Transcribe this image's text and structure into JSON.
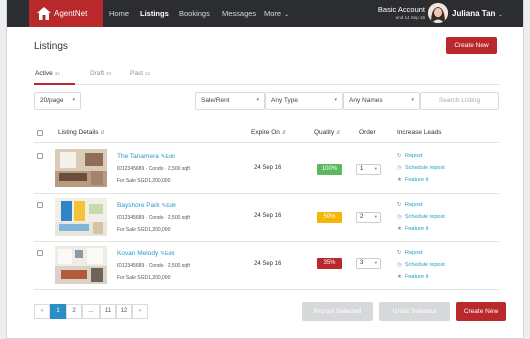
{
  "brand": {
    "name": "AgentNet"
  },
  "nav": {
    "items": [
      {
        "label": "Home"
      },
      {
        "label": "Listings"
      },
      {
        "label": "Bookings"
      },
      {
        "label": "Messages"
      },
      {
        "label": "More"
      }
    ]
  },
  "account": {
    "type": "Basic Account",
    "expiry": "end 14 Sep 16",
    "user_name": "Juliana Tan"
  },
  "page": {
    "title": "Listings",
    "create_button": "Create New"
  },
  "tabs": [
    {
      "label": "Active",
      "count": "34"
    },
    {
      "label": "Draft",
      "count": "34"
    },
    {
      "label": "Past",
      "count": "12"
    }
  ],
  "filters": {
    "per_page": "20/page",
    "sale_rent": "Sale/Rent",
    "type": "Any Type",
    "names": "Any Names",
    "search_placeholder": "Search Listing"
  },
  "table": {
    "headers": {
      "listing_details": "Listing Details",
      "expire_on": "Expire On",
      "quality": "Quality",
      "order": "Order",
      "increase_leads": "Increase Leads"
    },
    "edit_label": "Edit",
    "actions": [
      "Repost",
      "Schedule repost",
      "Feature it"
    ],
    "rows": [
      {
        "title": "The Tanamera",
        "meta": "ID12345689  ·  Condo  ·  2,500 sqft",
        "price": "For Sale SGD1,200,000",
        "expire": "24 Sep 16",
        "quality": "100%",
        "quality_color": "#5cb85c",
        "order": "1"
      },
      {
        "title": "Bayshore Park",
        "meta": "ID12345689  ·  Condo  ·  2,500 sqft",
        "price": "For Sale SGD1,200,000",
        "expire": "24 Sep 16",
        "quality": "50%",
        "quality_color": "#f2b705",
        "order": "2"
      },
      {
        "title": "Kovan Melody",
        "meta": "ID12345689  ·  Condo  ·  2,500 sqft",
        "price": "For Sale SGD1,200,000",
        "expire": "24 Sep 16",
        "quality": "35%",
        "quality_color": "#b9282a",
        "order": "3"
      }
    ]
  },
  "pagination": {
    "prev": "‹",
    "pages": [
      "1",
      "2",
      "...",
      "11",
      "12"
    ],
    "next": "›",
    "current": "1"
  },
  "bulk": {
    "repost": "Repost Selected",
    "unlist": "Unlist Selected",
    "create": "Create New"
  },
  "colors": {
    "brand_red": "#b9282a",
    "nav_bg": "#2b2d30",
    "link_blue": "#2a9ac7",
    "pager_active": "#2a8fc6"
  }
}
